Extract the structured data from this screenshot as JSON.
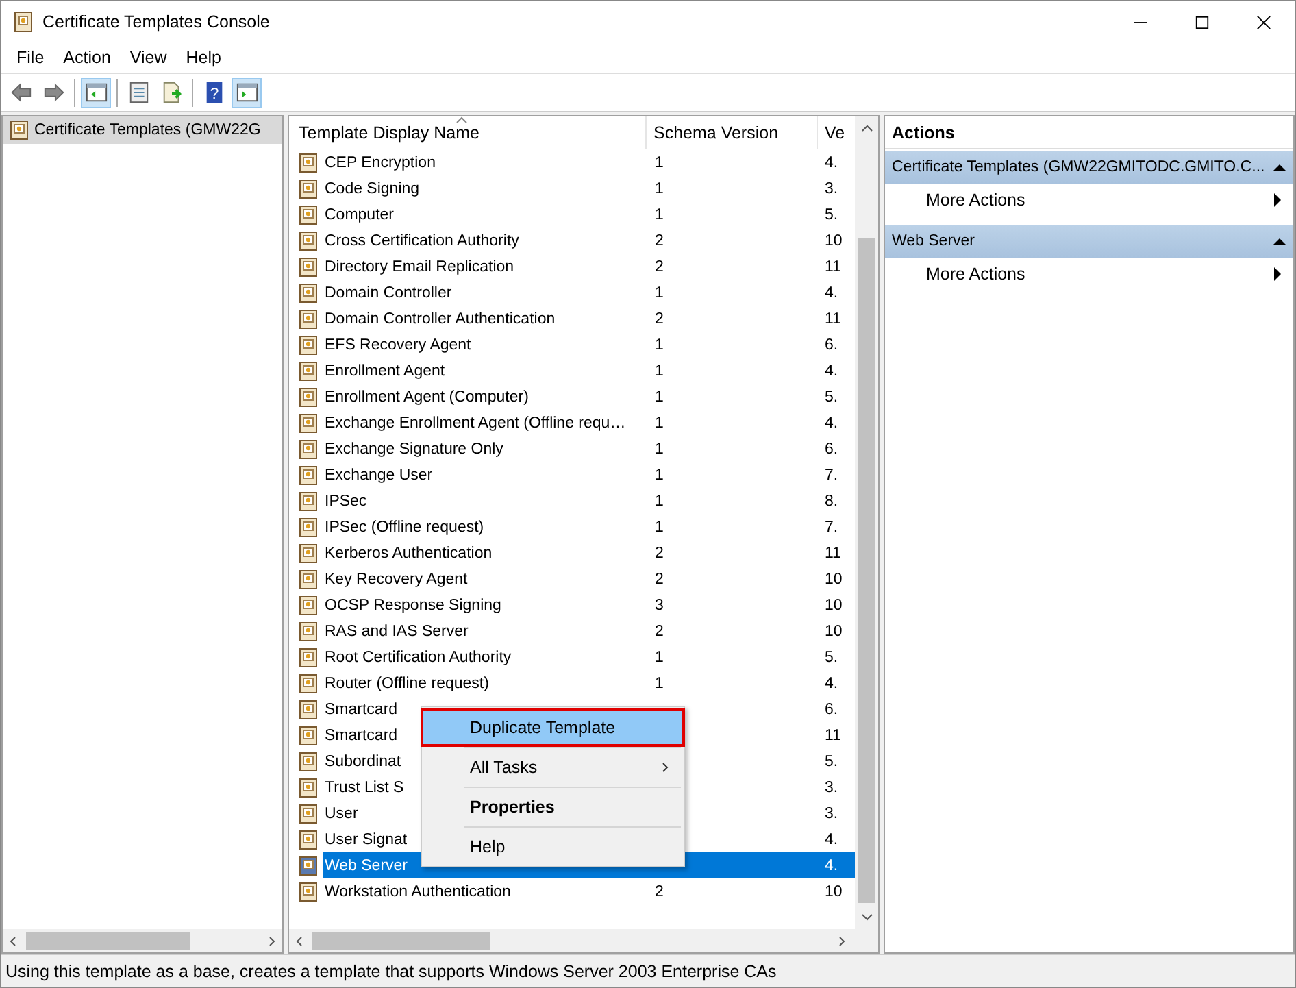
{
  "window": {
    "title": "Certificate Templates Console"
  },
  "menu": [
    "File",
    "Action",
    "View",
    "Help"
  ],
  "toolbar": [
    {
      "kind": "back",
      "selected": false
    },
    {
      "kind": "forward",
      "selected": false
    },
    {
      "kind": "tree",
      "selected": true
    },
    {
      "kind": "props",
      "selected": false
    },
    {
      "kind": "export",
      "selected": false
    },
    {
      "kind": "help",
      "glyph": "?",
      "selected": false
    },
    {
      "kind": "actions",
      "selected": true
    }
  ],
  "tree": {
    "items": [
      {
        "label": "Certificate Templates (GMW22G",
        "selected": true
      }
    ]
  },
  "table": {
    "columns": [
      "Template Display Name",
      "Schema Version",
      "Ve"
    ],
    "rows": [
      {
        "name": "CEP Encryption",
        "schema": "1",
        "version": "4.",
        "selected": false
      },
      {
        "name": "Code Signing",
        "schema": "1",
        "version": "3.",
        "selected": false
      },
      {
        "name": "Computer",
        "schema": "1",
        "version": "5.",
        "selected": false
      },
      {
        "name": "Cross Certification Authority",
        "schema": "2",
        "version": "10",
        "selected": false
      },
      {
        "name": "Directory Email Replication",
        "schema": "2",
        "version": "11",
        "selected": false
      },
      {
        "name": "Domain Controller",
        "schema": "1",
        "version": "4.",
        "selected": false
      },
      {
        "name": "Domain Controller Authentication",
        "schema": "2",
        "version": "11",
        "selected": false
      },
      {
        "name": "EFS Recovery Agent",
        "schema": "1",
        "version": "6.",
        "selected": false
      },
      {
        "name": "Enrollment Agent",
        "schema": "1",
        "version": "4.",
        "selected": false
      },
      {
        "name": "Enrollment Agent (Computer)",
        "schema": "1",
        "version": "5.",
        "selected": false
      },
      {
        "name": "Exchange Enrollment Agent (Offline requ…",
        "schema": "1",
        "version": "4.",
        "selected": false
      },
      {
        "name": "Exchange Signature Only",
        "schema": "1",
        "version": "6.",
        "selected": false
      },
      {
        "name": "Exchange User",
        "schema": "1",
        "version": "7.",
        "selected": false
      },
      {
        "name": "IPSec",
        "schema": "1",
        "version": "8.",
        "selected": false
      },
      {
        "name": "IPSec (Offline request)",
        "schema": "1",
        "version": "7.",
        "selected": false
      },
      {
        "name": "Kerberos Authentication",
        "schema": "2",
        "version": "11",
        "selected": false
      },
      {
        "name": "Key Recovery Agent",
        "schema": "2",
        "version": "10",
        "selected": false
      },
      {
        "name": "OCSP Response Signing",
        "schema": "3",
        "version": "10",
        "selected": false
      },
      {
        "name": "RAS and IAS Server",
        "schema": "2",
        "version": "10",
        "selected": false
      },
      {
        "name": "Root Certification Authority",
        "schema": "1",
        "version": "5.",
        "selected": false
      },
      {
        "name": "Router (Offline request)",
        "schema": "1",
        "version": "4.",
        "selected": false
      },
      {
        "name": "Smartcard",
        "version": "6.",
        "selected": false
      },
      {
        "name": "Smartcard",
        "version": "11",
        "selected": false
      },
      {
        "name": "Subordinat",
        "version": "5.",
        "selected": false
      },
      {
        "name": "Trust List S",
        "version": "3.",
        "selected": false
      },
      {
        "name": "User",
        "version": "3.",
        "selected": false
      },
      {
        "name": "User Signat",
        "version": "4.",
        "selected": false
      },
      {
        "name": "Web Server",
        "version": "4.",
        "selected": true
      },
      {
        "name": "Workstation Authentication",
        "schema": "2",
        "version": "10",
        "selected": false
      }
    ]
  },
  "context_menu": {
    "items": [
      {
        "label": "Duplicate Template",
        "selected": true,
        "bold": false,
        "submenu": false
      },
      {
        "label": "All Tasks",
        "selected": false,
        "bold": false,
        "submenu": true
      },
      {
        "label": "Properties",
        "selected": false,
        "bold": true,
        "submenu": false
      },
      {
        "label": "Help",
        "selected": false,
        "bold": false,
        "submenu": false
      }
    ]
  },
  "actions": {
    "title": "Actions",
    "groups": [
      {
        "title": "Certificate Templates (GMW22GMITODC.GMITO.C...",
        "items": [
          "More Actions"
        ]
      },
      {
        "title": "Web Server",
        "items": [
          "More Actions"
        ]
      }
    ]
  },
  "status_bar": "Using this template as a base, creates a template that supports Windows Server 2003 Enterprise CAs"
}
